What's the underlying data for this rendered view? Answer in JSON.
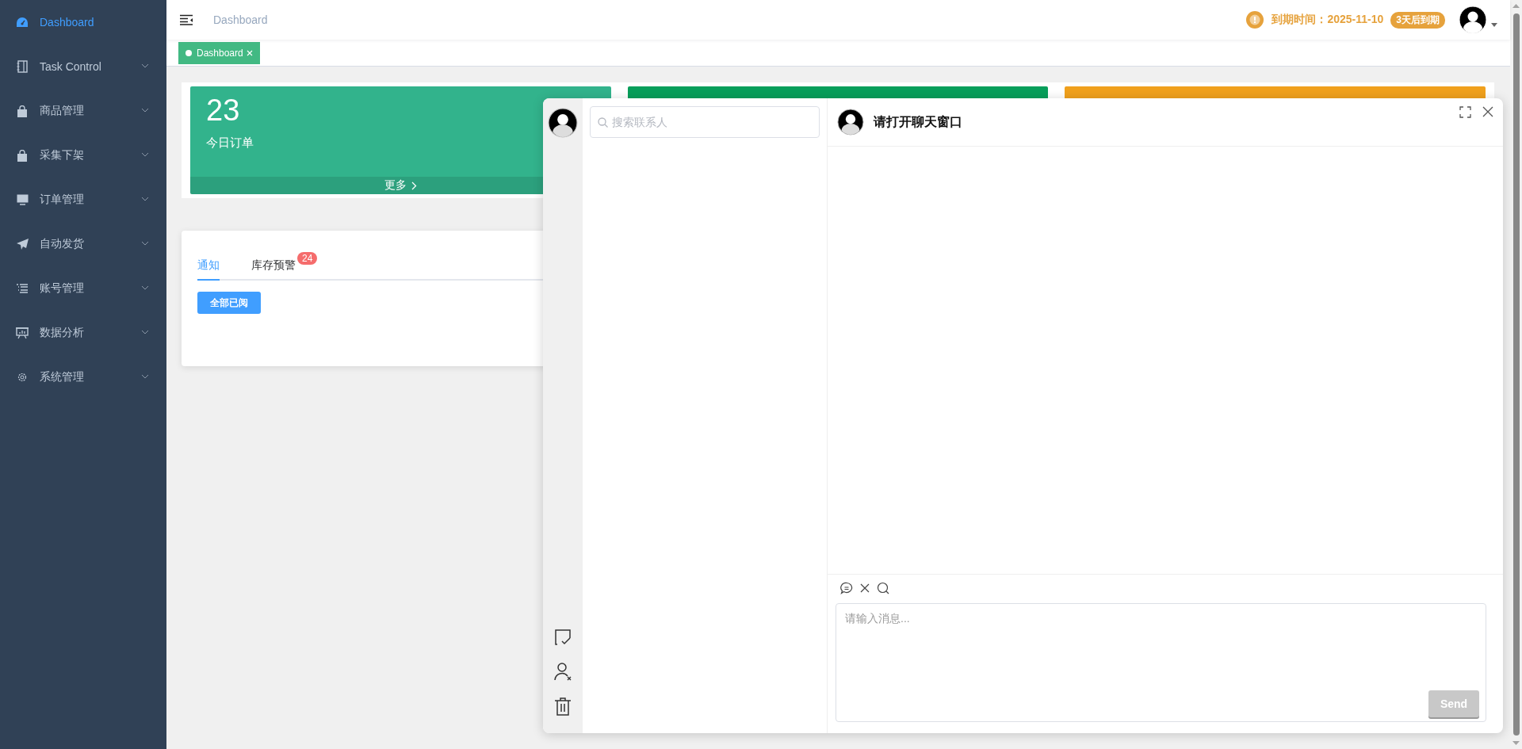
{
  "sidebar": {
    "items": [
      {
        "label": "Dashboard",
        "selected": true,
        "expandable": false
      },
      {
        "label": "Task Control",
        "selected": false,
        "expandable": true
      },
      {
        "label": "商品管理",
        "selected": false,
        "expandable": true
      },
      {
        "label": "采集下架",
        "selected": false,
        "expandable": true
      },
      {
        "label": "订单管理",
        "selected": false,
        "expandable": true
      },
      {
        "label": "自动发货",
        "selected": false,
        "expandable": true
      },
      {
        "label": "账号管理",
        "selected": false,
        "expandable": true
      },
      {
        "label": "数据分析",
        "selected": false,
        "expandable": true
      },
      {
        "label": "系统管理",
        "selected": false,
        "expandable": true
      }
    ]
  },
  "header": {
    "breadcrumb": "Dashboard",
    "expiry_label": "到期时间：2025-11-10",
    "expiry_badge": "3天后到期"
  },
  "tabs": [
    {
      "label": "Dashboard",
      "selected": true
    }
  ],
  "cards": [
    {
      "value": "23",
      "label": "今日订单",
      "more": "更多",
      "color": "#32b38c"
    },
    {
      "color": "#079e5a"
    },
    {
      "color": "#f0a01c"
    }
  ],
  "notice": {
    "tabs": [
      {
        "label": "通知",
        "selected": true
      },
      {
        "label": "库存预警",
        "selected": false,
        "badge": "24"
      }
    ],
    "button": "全部已阅"
  },
  "chat": {
    "search_placeholder": "搜索联系人",
    "title": "请打开聊天窗口",
    "input_placeholder": "请输入消息...",
    "send": "Send",
    "send_disabled": true
  }
}
